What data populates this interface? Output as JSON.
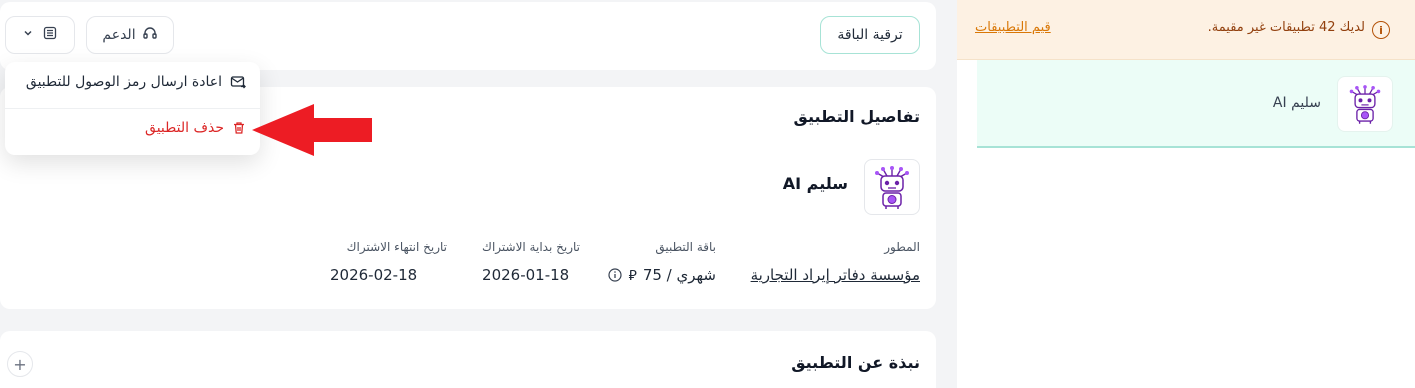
{
  "toolbar": {
    "upgrade_label": "ترقية الباقة",
    "support_label": "الدعم"
  },
  "dropdown": {
    "resend_label": "اعادة ارسال رمز الوصول للتطبيق",
    "delete_label": "حذف التطبيق"
  },
  "details": {
    "title": "تفاصيل التطبيق",
    "app_name": "سليم AI",
    "developer_label": "المطور",
    "developer_value": "مؤسسة دفاتر إيراد التجارية",
    "package_label": "باقة التطبيق",
    "package_value": "شهري / 75",
    "start_label": "تاريخ بداية الاشتراك",
    "start_value": "2026-01-18",
    "end_label": "تاريخ انتهاء الاشتراك",
    "end_value": "2026-02-18"
  },
  "about": {
    "title": "نبذة عن التطبيق"
  },
  "sidebar": {
    "notice_text": "لديك 42 تطبيقات غير مقيمة.",
    "notice_link": "قيم التطبيقات",
    "app_name": "سليم AI"
  },
  "colors": {
    "accent_teal": "#a7e3d6",
    "danger": "#dc2626",
    "notice_bg": "#fdf1e3",
    "arrow": "#ed1c24"
  }
}
